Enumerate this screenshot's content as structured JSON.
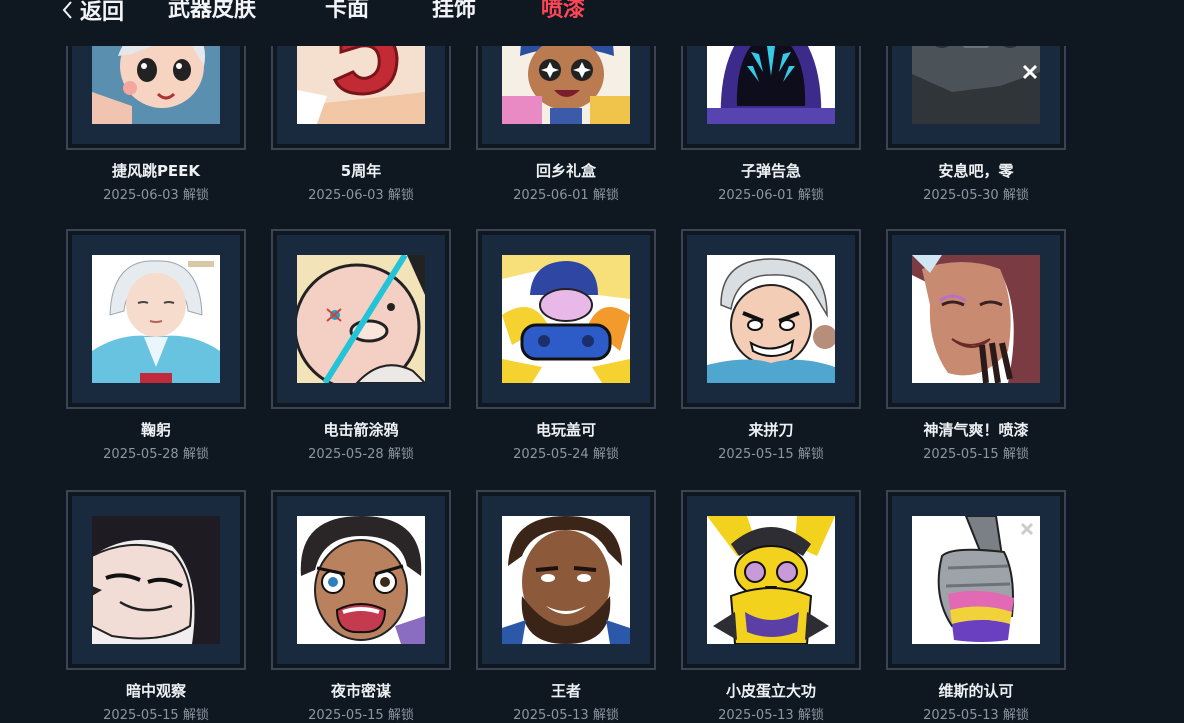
{
  "nav": {
    "back_label": "返回",
    "tabs": [
      {
        "label": "武器皮肤"
      },
      {
        "label": "卡面"
      },
      {
        "label": "挂饰"
      },
      {
        "label": "喷漆"
      }
    ],
    "active_tab": "喷漆"
  },
  "colors": {
    "background": "#0f1721",
    "accent": "#ff4656",
    "tile": "#1a2a3e"
  },
  "unlock_word": "解锁",
  "sprays": [
    {
      "name": "捷风跳PEEK",
      "date": "2025-06-03 解锁",
      "icon": "jett-peek-spray"
    },
    {
      "name": "5周年",
      "date": "2025-06-03 解锁",
      "icon": "fifth-anniversary-spray"
    },
    {
      "name": "回乡礼盒",
      "date": "2025-06-01 解锁",
      "icon": "gift-box-spray"
    },
    {
      "name": "子弹告急",
      "date": "2025-06-01 解锁",
      "icon": "hooded-agent-spray"
    },
    {
      "name": "安息吧，零",
      "date": "2025-05-30 解锁",
      "icon": "rip-zero-spray"
    },
    {
      "name": "鞠躬",
      "date": "2025-05-28 解锁",
      "icon": "bowing-agent-spray"
    },
    {
      "name": "电击箭涂鸦",
      "date": "2025-05-28 解锁",
      "icon": "shock-dart-spray"
    },
    {
      "name": "电玩盖可",
      "date": "2025-05-24 解锁",
      "icon": "gamer-gekko-spray"
    },
    {
      "name": "来拼刀",
      "date": "2025-05-15 解锁",
      "icon": "knife-fight-spray"
    },
    {
      "name": "神清气爽！喷漆",
      "date": "2025-05-15 解锁",
      "icon": "refreshed-spray"
    },
    {
      "name": "暗中观察",
      "date": "2025-05-15 解锁",
      "icon": "peeking-agent-spray"
    },
    {
      "name": "夜市密谋",
      "date": "2025-05-15 解锁",
      "icon": "night-market-spray"
    },
    {
      "name": "王者",
      "date": "2025-05-13 解锁",
      "icon": "king-spray"
    },
    {
      "name": "小皮蛋立大功",
      "date": "2025-05-13 解锁",
      "icon": "yellow-critter-spray"
    },
    {
      "name": "维斯的认可",
      "date": "2025-05-13 解锁",
      "icon": "thumbs-up-spray"
    }
  ]
}
